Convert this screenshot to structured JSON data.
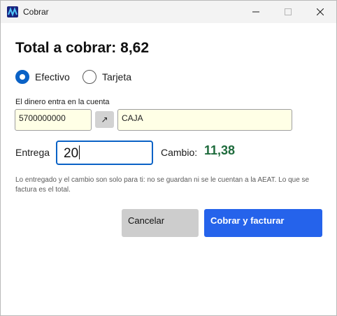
{
  "window": {
    "title": "Cobrar",
    "icon": "app-logo-icon",
    "accent_color": "#2563eb"
  },
  "dialog": {
    "heading": "Total a cobrar: 8,62",
    "payment_method": {
      "selected": "Efectivo",
      "options": [
        {
          "label": "Efectivo",
          "checked": true
        },
        {
          "label": "Tarjeta",
          "checked": false
        }
      ]
    },
    "account": {
      "caption": "El dinero entra en la cuenta",
      "code": "5700000000",
      "open_icon": "↗",
      "name": "CAJA"
    },
    "entrega": {
      "label": "Entrega",
      "value": "20"
    },
    "cambio": {
      "label": "Cambio:",
      "value": "11,38",
      "color": "#1e6b3c"
    },
    "note": "Lo entregado y el cambio son solo para ti: no se guardan ni se le cuentan a la AEAT. Lo que se factura es el total.",
    "buttons": {
      "cancel": "Cancelar",
      "charge": "Cobrar y facturar"
    }
  }
}
